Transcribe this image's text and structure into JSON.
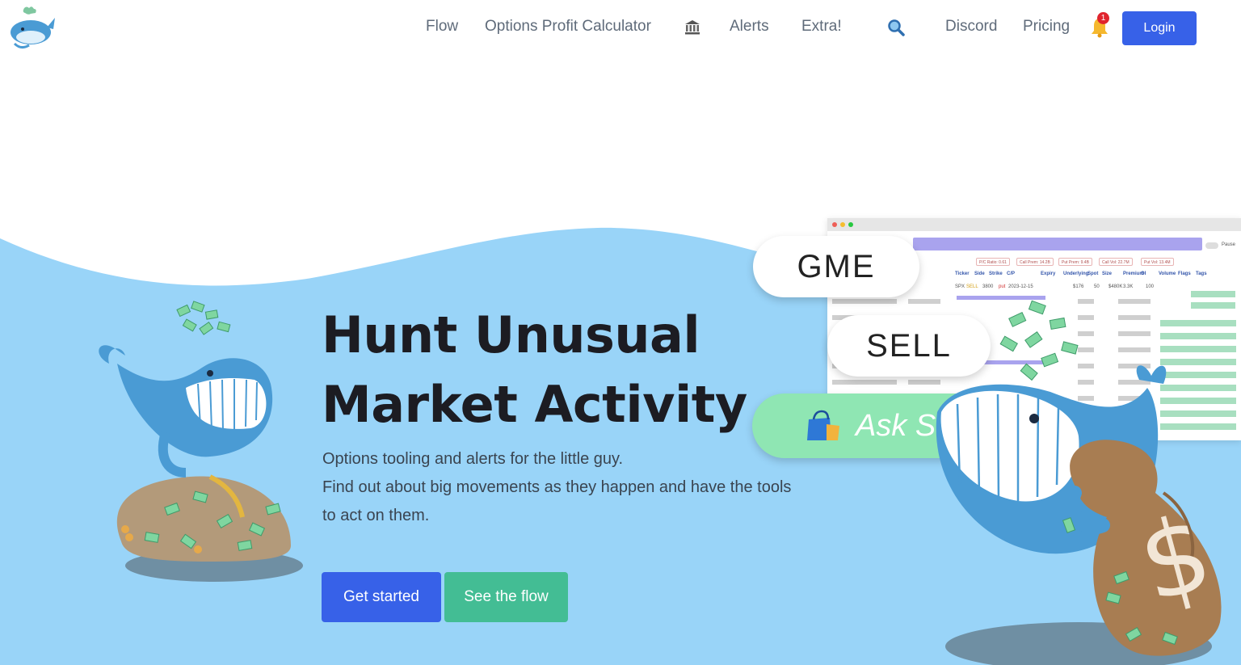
{
  "nav": {
    "links": [
      {
        "label": "Flow"
      },
      {
        "label": "Options Profit Calculator"
      },
      {
        "label": "Alerts"
      },
      {
        "label": "Extra!"
      },
      {
        "label": "Discord"
      },
      {
        "label": "Pricing"
      }
    ],
    "bank_icon": "bank-icon",
    "search_icon": "search-icon",
    "notification_count": "1",
    "login_label": "Login"
  },
  "hero": {
    "title_line1": "Hunt Unusual",
    "title_line2": "Market Activity",
    "subtitle_line1": "Options tooling and alerts for the little guy.",
    "subtitle_line2": "Find out about big movements as they happen and have the tools to act on them.",
    "get_started_label": "Get started",
    "see_flow_label": "See the flow"
  },
  "floating_pills": {
    "ticker": "GME",
    "side": "SELL",
    "ask": "Ask S"
  },
  "mock_table": {
    "stats": [
      "P/C Ratio: 0.61",
      "Call Prem: 14.2B",
      "Put Prem: 9.4B",
      "Call Vol: 22.7M",
      "Put Vol: 13.4M"
    ],
    "headers": [
      "Ticker",
      "Side",
      "Strike",
      "C/P",
      "Expiry",
      "Underlying",
      "Spot",
      "Size",
      "Premium",
      "OI",
      "Volume",
      "Flags",
      "Tags"
    ],
    "row": [
      "SPX",
      "SELL",
      "3800",
      "put",
      "2023-12-15",
      "",
      "$176",
      "50",
      "$480K",
      "3.3K",
      "100"
    ],
    "toggle_label": "Pause"
  },
  "colors": {
    "accent_blue": "#3761e8",
    "accent_green": "#43bd94",
    "sky": "#99d4f8"
  }
}
